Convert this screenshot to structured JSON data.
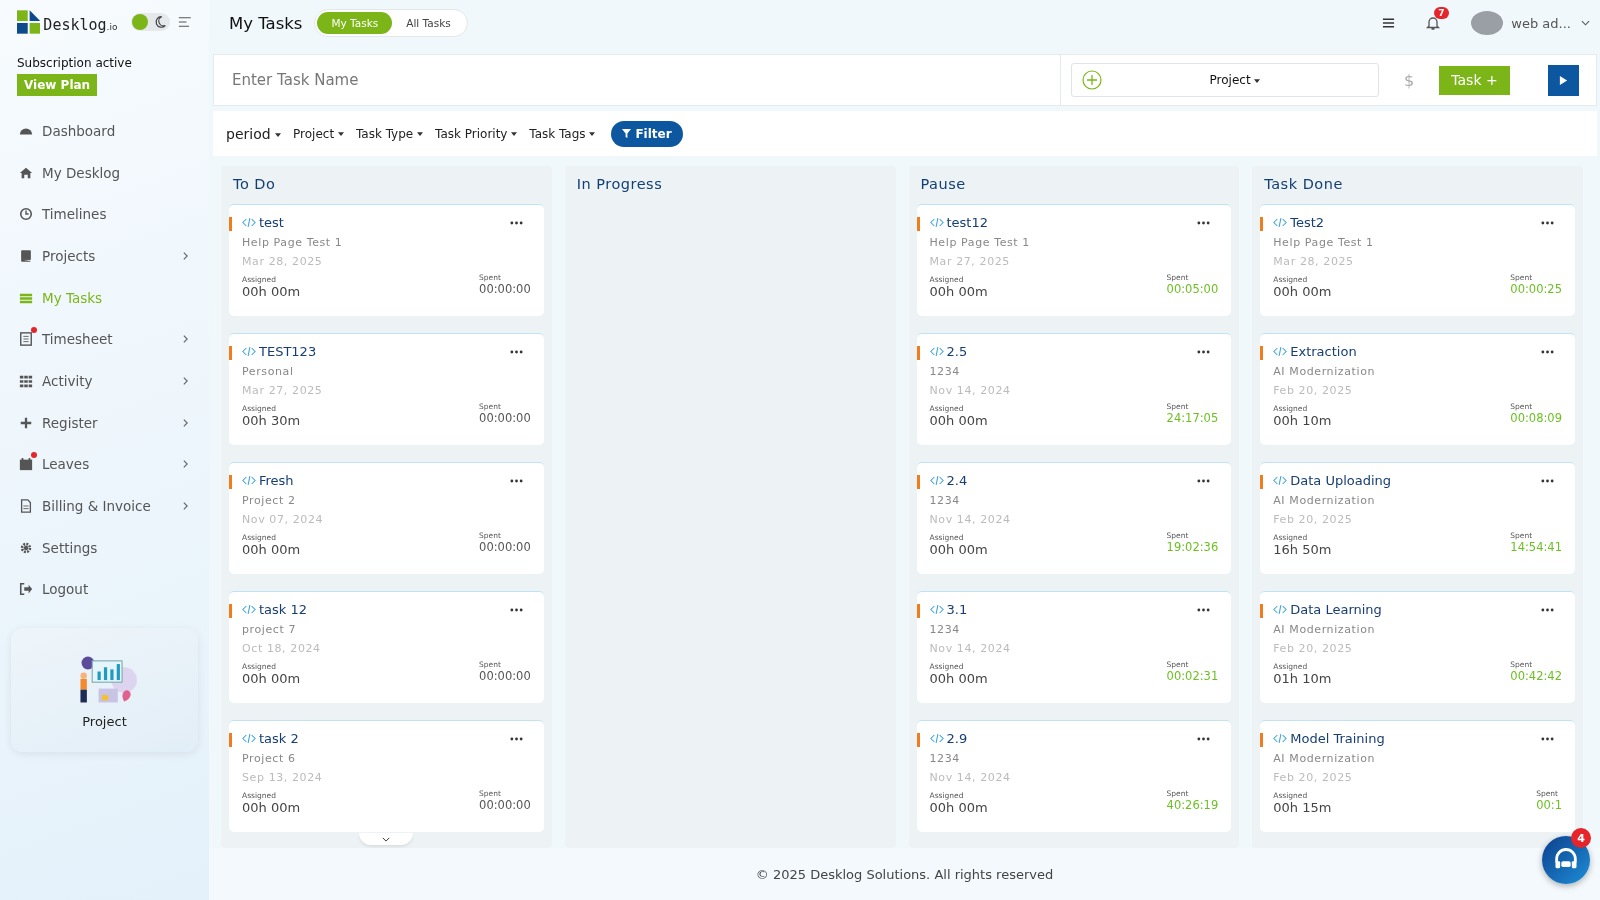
{
  "brand": {
    "name": "Desklog",
    "suffix": ".io"
  },
  "theme_switch": {
    "dark_mode": false
  },
  "subscription": {
    "status": "Subscription active",
    "button": "View Plan"
  },
  "sidebar": {
    "items": [
      {
        "label": "Dashboard",
        "selected": false,
        "submenu": false,
        "alert": false
      },
      {
        "label": "My Desklog",
        "selected": false,
        "submenu": false,
        "alert": false
      },
      {
        "label": "Timelines",
        "selected": false,
        "submenu": false,
        "alert": false
      },
      {
        "label": "Projects",
        "selected": false,
        "submenu": true,
        "alert": false
      },
      {
        "label": "My Tasks",
        "selected": true,
        "submenu": false,
        "alert": false
      },
      {
        "label": "Timesheet",
        "selected": false,
        "submenu": true,
        "alert": true
      },
      {
        "label": "Activity",
        "selected": false,
        "submenu": true,
        "alert": false
      },
      {
        "label": "Register",
        "selected": false,
        "submenu": true,
        "alert": false
      },
      {
        "label": "Leaves",
        "selected": false,
        "submenu": true,
        "alert": true
      },
      {
        "label": "Billing & Invoice",
        "selected": false,
        "submenu": true,
        "alert": false
      },
      {
        "label": "Settings",
        "selected": false,
        "submenu": false,
        "alert": false
      },
      {
        "label": "Logout",
        "selected": false,
        "submenu": false,
        "alert": false
      }
    ],
    "promo": {
      "label": "Project"
    }
  },
  "header": {
    "title": "My Tasks",
    "tabs": [
      {
        "label": "My Tasks",
        "selected": true
      },
      {
        "label": "All Tasks",
        "selected": false
      }
    ],
    "notifications": "7",
    "user": "web ad..."
  },
  "task_bar": {
    "placeholder": "Enter Task Name",
    "project": "Project",
    "currency": "$",
    "add_button": "Task +"
  },
  "filters": {
    "items": [
      "period",
      "Project",
      "Task Type",
      "Task Priority",
      "Task Tags"
    ],
    "button": "Filter"
  },
  "columns": [
    {
      "title": "To Do",
      "cards": [
        {
          "title": "test",
          "project": "Help Page Test 1",
          "date": "Mar 28, 2025",
          "assigned_label": "Assigned",
          "assigned": "00h 00m",
          "spent_label": "Spent",
          "spent": "00:00:00",
          "spent_active": false
        },
        {
          "title": "TEST123",
          "project": "Personal",
          "date": "Mar 27, 2025",
          "assigned_label": "Assigned",
          "assigned": "00h 30m",
          "spent_label": "Spent",
          "spent": "00:00:00",
          "spent_active": false
        },
        {
          "title": "Fresh",
          "project": "Project 2",
          "date": "Nov 07, 2024",
          "assigned_label": "Assigned",
          "assigned": "00h 00m",
          "spent_label": "Spent",
          "spent": "00:00:00",
          "spent_active": false
        },
        {
          "title": "task 12",
          "project": "project 7",
          "date": "Oct 18, 2024",
          "assigned_label": "Assigned",
          "assigned": "00h 00m",
          "spent_label": "Spent",
          "spent": "00:00:00",
          "spent_active": false
        },
        {
          "title": "task 2",
          "project": "Project 6",
          "date": "Sep 13, 2024",
          "assigned_label": "Assigned",
          "assigned": "00h 00m",
          "spent_label": "Spent",
          "spent": "00:00:00",
          "spent_active": false
        }
      ]
    },
    {
      "title": "In Progress"
    },
    {
      "title": "Pause",
      "cards": [
        {
          "title": "test12",
          "project": "Help Page Test 1",
          "date": "Mar 27, 2025",
          "assigned_label": "Assigned",
          "assigned": "00h 00m",
          "spent_label": "Spent",
          "spent": "00:05:00",
          "spent_active": true
        },
        {
          "title": "2.5",
          "project": "1234",
          "date": "Nov 14, 2024",
          "assigned_label": "Assigned",
          "assigned": "00h 00m",
          "spent_label": "Spent",
          "spent": "24:17:05",
          "spent_active": true
        },
        {
          "title": "2.4",
          "project": "1234",
          "date": "Nov 14, 2024",
          "assigned_label": "Assigned",
          "assigned": "00h 00m",
          "spent_label": "Spent",
          "spent": "19:02:36",
          "spent_active": true
        },
        {
          "title": "3.1",
          "project": "1234",
          "date": "Nov 14, 2024",
          "assigned_label": "Assigned",
          "assigned": "00h 00m",
          "spent_label": "Spent",
          "spent": "00:02:31",
          "spent_active": true
        },
        {
          "title": "2.9",
          "project": "1234",
          "date": "Nov 14, 2024",
          "assigned_label": "Assigned",
          "assigned": "00h 00m",
          "spent_label": "Spent",
          "spent": "40:26:19",
          "spent_active": true
        }
      ]
    },
    {
      "title": "Task Done",
      "cards": [
        {
          "title": "Test2",
          "project": "Help Page Test 1",
          "date": "Mar 28, 2025",
          "assigned_label": "Assigned",
          "assigned": "00h 00m",
          "spent_label": "Spent",
          "spent": "00:00:25",
          "spent_active": true
        },
        {
          "title": "Extraction",
          "project": "AI Modernization",
          "date": "Feb 20, 2025",
          "assigned_label": "Assigned",
          "assigned": "00h 10m",
          "spent_label": "Spent",
          "spent": "00:08:09",
          "spent_active": true
        },
        {
          "title": "Data Uploading",
          "project": "AI Modernization",
          "date": "Feb 20, 2025",
          "assigned_label": "Assigned",
          "assigned": "16h 50m",
          "spent_label": "Spent",
          "spent": "14:54:41",
          "spent_active": true
        },
        {
          "title": "Data Learning",
          "project": "AI Modernization",
          "date": "Feb 20, 2025",
          "assigned_label": "Assigned",
          "assigned": "01h 10m",
          "spent_label": "Spent",
          "spent": "00:42:42",
          "spent_active": true
        },
        {
          "title": "Model Training",
          "project": "AI Modernization",
          "date": "Feb 20, 2025",
          "assigned_label": "Assigned",
          "assigned": "00h 15m",
          "spent_label": "Spent",
          "spent": "00:1",
          "spent_active": true
        }
      ]
    }
  ],
  "chat": {
    "count": "4"
  },
  "footer": "© 2025 Desklog Solutions. All rights reserved"
}
